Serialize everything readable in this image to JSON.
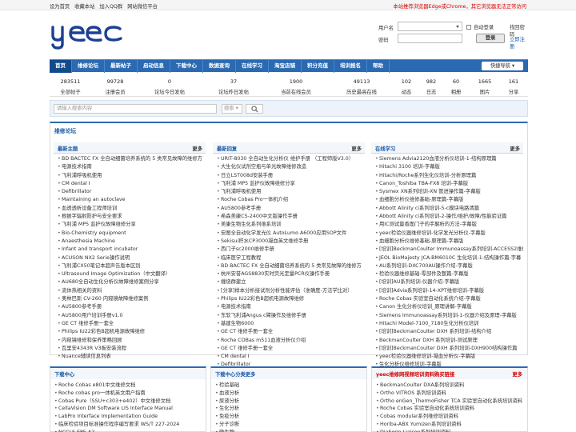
{
  "topbar": {
    "links": [
      "设为首页",
      "收藏本站",
      "加入QQ群",
      "网站微信平台"
    ],
    "notice": "本站推荐浏览器Edge或Chrome，其它浏览器无法正常访问"
  },
  "login": {
    "username_label": "用户名",
    "password_label": "密码",
    "auto_login": "自动登录",
    "find_password": "找回密码",
    "login_button": "登录",
    "register": "立即注册"
  },
  "nav": {
    "items": [
      "首页",
      "维修论坛",
      "最新帖子",
      "启动信息",
      "下载中心",
      "数据查询",
      "在线学习",
      "淘宝店铺",
      "积分充值",
      "培训报名",
      "帮助"
    ],
    "quick": "快捷导航"
  },
  "stats": [
    {
      "n": "283511",
      "l": "全部帖子"
    },
    {
      "n": "99728",
      "l": "注册会员"
    },
    {
      "n": "0",
      "l": "论坛今日发帖"
    },
    {
      "n": "37",
      "l": "论坛昨日发帖"
    },
    {
      "n": "1900",
      "l": "当前在线会员"
    },
    {
      "n": "49113",
      "l": "历史最高在线"
    },
    {
      "n": "102",
      "l": "动态"
    },
    {
      "n": "982",
      "l": "日志"
    },
    {
      "n": "60",
      "l": "相册"
    },
    {
      "n": "1665",
      "l": "图片"
    },
    {
      "n": "161",
      "l": "分享"
    }
  ],
  "search": {
    "placeholder": "请输入搜索内容",
    "select": "搜索"
  },
  "section": {
    "title": "维修论坛",
    "cols": [
      {
        "title": "最新主题",
        "more": "更多",
        "items": [
          "BD BACTEC FX 全自动细菌培养系统的 5 类常见故障的维修方",
          "电源技术指南",
          "飞利浦呼吸机使用",
          "CM dental I",
          "Defibrillator",
          "Maintaining an autoclave",
          "血透透析设备工程师培训",
          "根据字辐射防护与安全要求",
          "飞利浦 MP5 监护仪故障维修分享",
          "Bio-Chemistry equipment",
          "Anaesthesia Machine",
          "Infant and transport incubator",
          "ACUSON NX2 Serie操作说明",
          "飞利浦CX50笔记本超声告版本区别",
          "Ultrasound Image Optimization（中文翻译）",
          "AU680全自动生化分析仪故障维修案例分享",
          "流体热相关的资料",
          "奥林巴斯 CV-260 内窥镜故障维修案例",
          "AU5800参考手册",
          "AU5800用户培训手册v1.0",
          "GE CT 维修手册一套全",
          "Philips IU22彩色B超机电源故障维修",
          "内窥镜维修和保养策略回顾",
          "瓦里安4343R V3板安装流程",
          "Nuance辅读信息列表"
        ]
      },
      {
        "title": "最新回复",
        "more": "更多",
        "items": [
          "URIT-8030 全自动生化分析仪 维护手册 （工程师版V3.0）",
          "大生化仪试剂空瓶与单光故障维修改造",
          "日立LST008d安装手册",
          "飞利浦 MP5 监护仪故障维修分享",
          "飞利浦呼吸机使用",
          "Roche Cobas Pro一体机介绍",
          "AU5800参考手册",
          "希森美康CS-2400中文版操作手册",
          "美康生物生化系列维系培训",
          "安图全自动化学发光仪 AutoLumo A6000应用SOP文件",
          "Sekisui积水CP3000凝血英文维修手册",
          "西门子sc2000维修手册",
          "临床医学工程教程",
          "BD BACTEC FX 全自动细菌培养系统的 5 类常见故障的维修方",
          "杭州安誉AGS8830实时荧光定量PCR仪操作手册",
          "缠烧群建立",
          "[分享]样本分析接试剂分析性能评估（准确度-方法学比对）",
          "Philips IU22彩色B超机电源故障维修",
          "电源技术指南",
          "东软飞利浦Angus c臂操作及维修手册",
          "基建生物6000",
          "GE CT 维修手册一套全",
          "Roche COBas m511血液分析仪介绍",
          "GE CT 维修手册一套全",
          "CM dental I",
          "Defibrillator"
        ]
      },
      {
        "title": "在线学习",
        "more": "更多",
        "items": [
          "Siemens Advia2120血液分析仪培训-1-结构原理篇",
          "Hitachi 3100 培训-字幕版",
          "Hitachi/Roche系列生化仪培训-分析原理篇",
          "Canon_Toshiba TBA-FX8 培训-字幕版",
          "Sysmex XN系列培训-XN 管进操作篇-字幕版",
          "血细胞分析仪维修基础-原理篇-字幕版",
          "Abbott Alinity ci系列培训-5-c模块电路清篇",
          "Abbott Alinity ci系列培训-2-操作/维护/故障/性能验证篇",
          "用IC测试量香面门子的手解析的方法-字幕版",
          "yeec检验仪器维修培训-化学发光分析仪-字幕版",
          "血细胞分析仪维修基础-原理篇-字幕版",
          "[培训]BeckmanCoulter Immunoassay系列培训-ACCESS2维修培训",
          "JEOL BioMajesty JCA-BM6010C 生化培训-1-结构操作篇-字幕",
          "AU系列培训-DXC700AU操作介绍-字幕版",
          "检验仪器维修基础-零部件及整篇-字幕版",
          "[培训]AU系列培训-仪器介绍-字幕版",
          "[培训]Advia系列培训-14-XPT维修培训-字幕版",
          "Roche Cobas 实验室自动化系统介绍-字幕版",
          "Canon 生化分析仪培训_原理讲解-字幕版",
          "Siemens Immunoassay系列培训-1-仪器介绍及原理-字幕版",
          "Hitachi Model-7100_7180生化分析仪培训",
          "[培训]BeckmanCoulter DXH 系列培训-结构介绍",
          "BeckmanCoulter DXH 系列培训-测试原理",
          "[培训]BeckmanCoulter DXH 系列培训-DXH900结构操作篇",
          "yeec检验仪器维修培训-凝血分析仪-字幕版",
          "生化分析仪维修培训-字幕版"
        ]
      }
    ]
  },
  "bottom": [
    {
      "title": "下载中心",
      "more": "",
      "items": [
        "Roche Cobas e801中文维修文档",
        "Roche cobas pro一体机英文用户指南",
        "Cobas Pure（SSU+c303+e402）中文维修文档",
        "CellaVision DM Software LIS Interface Manual",
        "LabPro Interface Implementation Guide",
        "临床检验项目标准操作程序编写要求 WS/T 227-2024",
        "NCCLS EP5-A2"
      ]
    },
    {
      "title": "下载中心分类更多",
      "more": "",
      "items": [
        "检验基础",
        "血液分析",
        "尿液分析",
        "生化分析",
        "免疫分析",
        "分子诊断",
        "微生物"
      ]
    },
    {
      "title": "yeec维修网视频培训资料购买链接",
      "more": "更多",
      "items": [
        "BeckmanCoulter DXA系列培训资料",
        "Ortho VITROS 系列培训资料",
        "Ortho enGen_ThermoFisher TCA 实验室自动化系统培训资料",
        "Roche Cobas 实验室自动化系统培训资料",
        "Cobas modular系列维修培训资料",
        "Horiba-ABX Yumizen系列培训资料",
        "DiaSorin Liaison系列培训资料"
      ]
    }
  ],
  "colors": {
    "nav": "#2a6ab2",
    "accent_red": "#d40000",
    "link_blue": "#1a5aa6"
  }
}
